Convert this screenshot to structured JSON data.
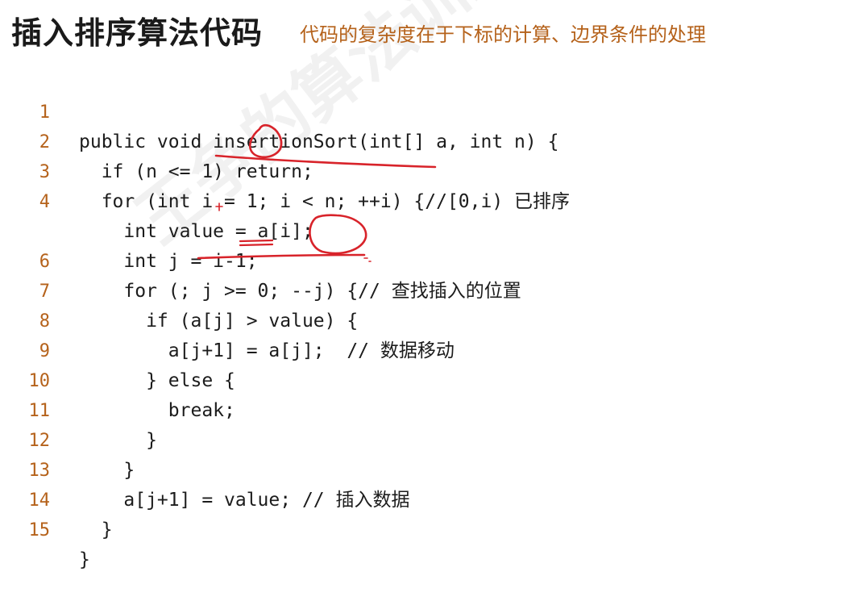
{
  "slide": {
    "title": "插入排序算法代码",
    "subtitle": "代码的复杂度在于下标的计算、边界条件的处理",
    "watermark": "王争的算法训练营"
  },
  "code": {
    "lines": [
      {
        "no": "1",
        "text": "public void insertionSort(int[] a, int n) {"
      },
      {
        "no": "2",
        "text": "  if (n <= 1) return;"
      },
      {
        "no": "3",
        "text": "  for (int i = 1; i < n; ++i) {//[0,i) 已排序"
      },
      {
        "no": "4",
        "text": "    int value = a[i];"
      },
      {
        "no": "",
        "text": "    int j = i-1;"
      },
      {
        "no": "6",
        "text": "    for (; j >= 0; --j) {// 查找插入的位置"
      },
      {
        "no": "7",
        "text": "      if (a[j] > value) {"
      },
      {
        "no": "8",
        "text": "        a[j+1] = a[j];  // 数据移动"
      },
      {
        "no": "9",
        "text": "      } else {"
      },
      {
        "no": "10",
        "text": "        break;"
      },
      {
        "no": "11",
        "text": "      }"
      },
      {
        "no": "12",
        "text": "    }"
      },
      {
        "no": "13",
        "text": "    a[j+1] = value; // 插入数据"
      },
      {
        "no": "14",
        "text": "  }"
      },
      {
        "no": "15",
        "text": "}"
      }
    ]
  },
  "colors": {
    "accent": "#b5621b",
    "ink": "#d8232a",
    "text": "#1c1c1c"
  }
}
